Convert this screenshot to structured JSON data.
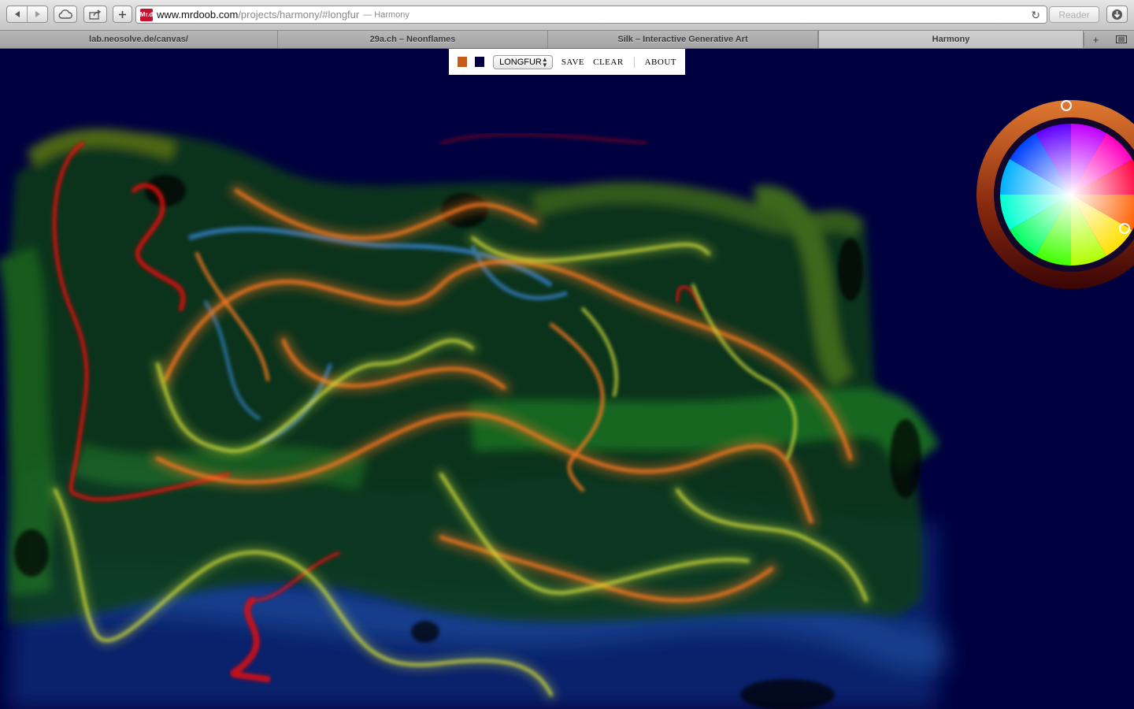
{
  "toolbar": {
    "url_host": "www.mrdoob.com",
    "url_path": "/projects/harmony/#longfur",
    "page_title_suffix": "— Harmony",
    "favicon_text": "Mr.d",
    "reader_label": "Reader"
  },
  "tabs": [
    {
      "label": "lab.neosolve.de/canvas/"
    },
    {
      "label": "29a.ch – Neonflames"
    },
    {
      "label": "Silk – Interactive Generative Art"
    },
    {
      "label": "Harmony"
    }
  ],
  "harmony_menu": {
    "foreground_color": "#c95b19",
    "background_color": "#000040",
    "brush_selected": "LONGFUR",
    "save_label": "SAVE",
    "clear_label": "CLEAR",
    "about_label": "ABOUT"
  },
  "colors": {
    "canvas_background": "#000040",
    "stroke_orange": "#e8691f",
    "stroke_yellow": "#d6e03a",
    "stroke_red": "#e01010",
    "stroke_green": "#2c8a1e",
    "stroke_blue": "#3a7fd0"
  }
}
